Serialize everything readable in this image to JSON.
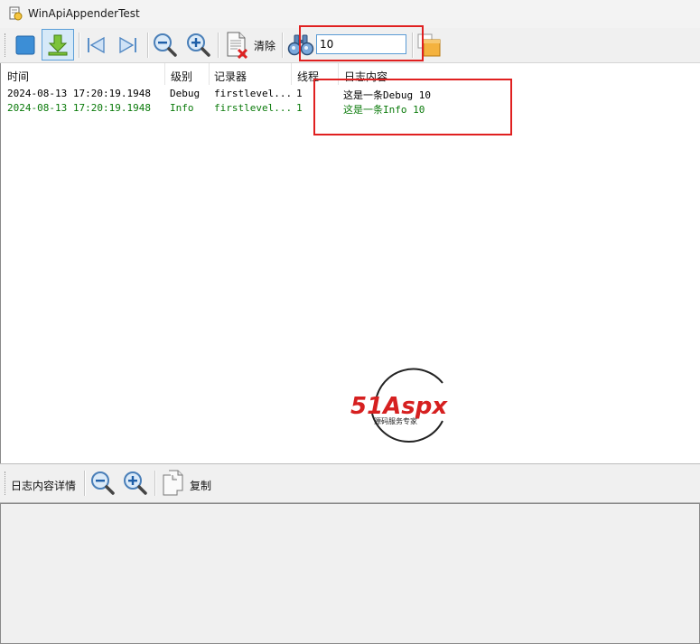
{
  "window": {
    "title": "WinApiAppenderTest"
  },
  "toolbar": {
    "clear_label": "清除",
    "search_value": "10"
  },
  "log_table": {
    "columns": [
      "时间",
      "级别",
      "记录器",
      "线程",
      "日志内容"
    ],
    "rows": [
      {
        "time": "2024-08-13 17:20:19.1948",
        "level": "Debug",
        "logger": "firstlevel...",
        "thread": "1",
        "message": "这是一条Debug 10"
      },
      {
        "time": "2024-08-13 17:20:19.1948",
        "level": "Info",
        "logger": "firstlevel...",
        "thread": "1",
        "message": "这是一条Info 10"
      }
    ]
  },
  "detail": {
    "title": "日志内容详情",
    "copy_label": "复制"
  },
  "colors": {
    "debug_text": "#000000",
    "info_text": "#0a7a0a",
    "highlight": "#e02020",
    "accent": "#5a9bd5"
  },
  "watermark": {
    "text": "51Aspx",
    "subtext": "源码服务专家"
  }
}
